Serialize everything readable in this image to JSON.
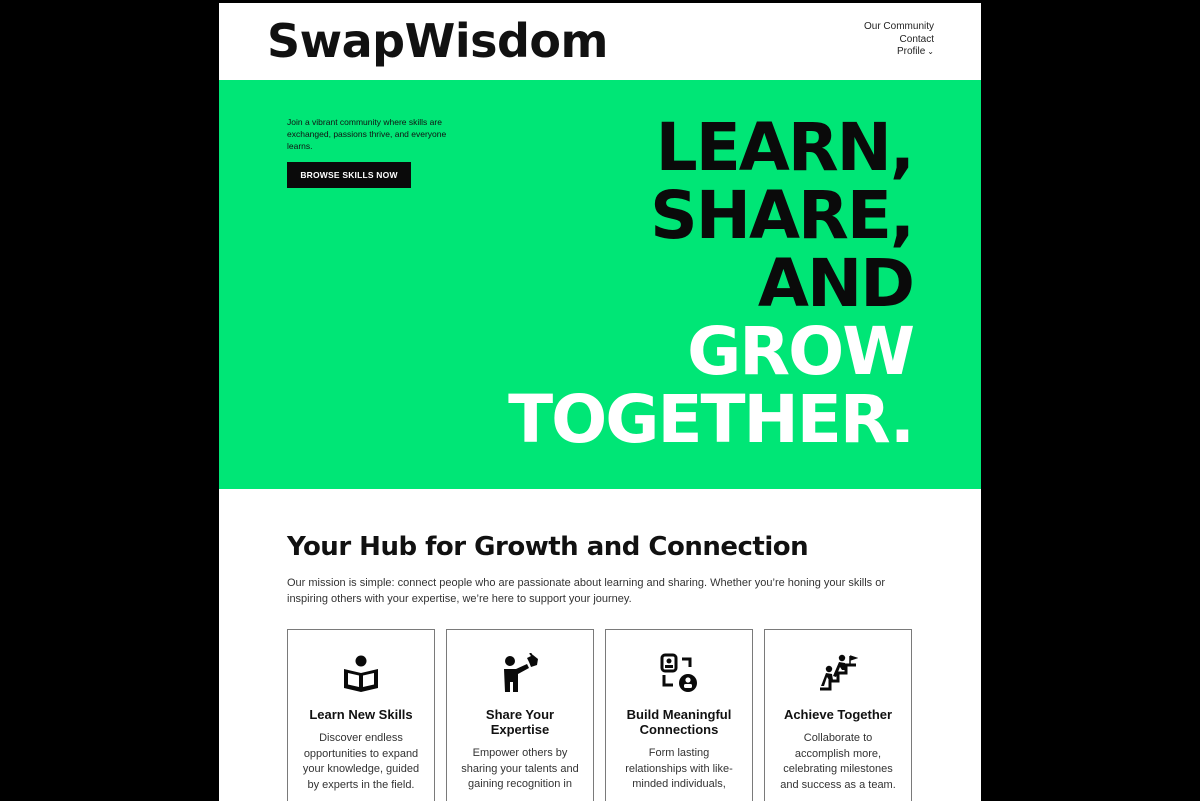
{
  "header": {
    "logo": "SwapWisdom",
    "nav": {
      "community": "Our Community",
      "contact": "Contact",
      "profile": "Profile"
    }
  },
  "hero": {
    "tagline": "Join a vibrant community where skills are exchanged, passions thrive, and everyone learns.",
    "button_label": "BROWSE SKILLS NOW",
    "headline": [
      "LEARN,",
      "SHARE,",
      "AND",
      "GROW",
      "TOGETHER."
    ],
    "accent_color": "#00e676"
  },
  "mission": {
    "title": "Your Hub for Growth and Connection",
    "text": "Our mission is simple: connect people who are passionate about learning and sharing. Whether you’re honing your skills or inspiring others with your expertise, we’re here to support your journey."
  },
  "cards": [
    {
      "icon": "book-reader-icon",
      "title": "Learn New Skills",
      "text": "Discover endless opportunities to expand your knowledge, guided by experts in the field."
    },
    {
      "icon": "presenter-icon",
      "title": "Share Your Expertise",
      "text": "Empower others by sharing your talents and gaining recognition in"
    },
    {
      "icon": "connections-icon",
      "title": "Build Meaningful Connections",
      "text": "Form lasting relationships with like-minded individuals,"
    },
    {
      "icon": "teamwork-icon",
      "title": "Achieve Together",
      "text": "Collaborate to accomplish more, celebrating milestones and success as a team."
    }
  ]
}
